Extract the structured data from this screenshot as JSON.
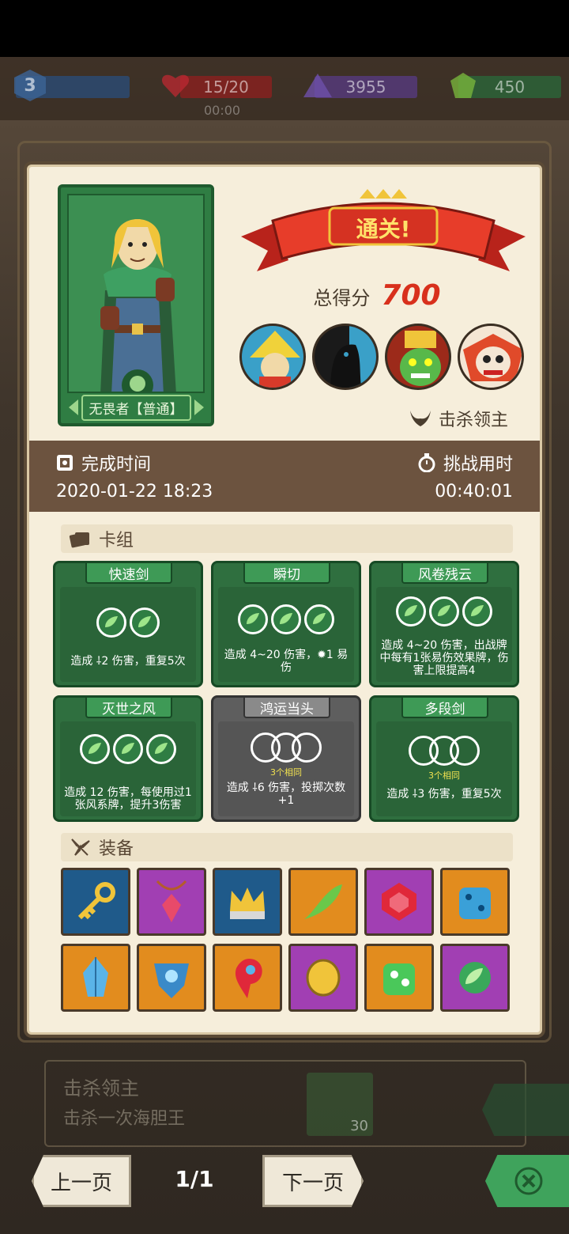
{
  "topbar": {
    "level": "3",
    "hp": "15/20",
    "gems": "3955",
    "money": "450",
    "timer": "00:00"
  },
  "result": {
    "banner": "通关!",
    "score_label": "总得分",
    "score_value": "700",
    "kill_label": "击杀领主"
  },
  "hero": {
    "name": "无畏者【普通】"
  },
  "times": {
    "complete_label": "完成时间",
    "complete_value": "2020-01-22 18:23",
    "challenge_label": "挑战用时",
    "challenge_value": "00:40:01"
  },
  "deck": {
    "title": "卡组",
    "cards": [
      {
        "name": "快速剑",
        "text": "造成 ⸸2 伤害，重复5次"
      },
      {
        "name": "瞬切",
        "text": "造成 4~20 伤害，✹1 易伤"
      },
      {
        "name": "风卷残云",
        "text": "造成 4~20 伤害，出战牌中每有1张易伤效果牌，伤害上限提高4"
      },
      {
        "name": "灭世之风",
        "text": "造成 12 伤害，每使用过1张风系牌，提升3伤害"
      },
      {
        "name": "鸿运当头",
        "note": "3个相同",
        "text": "造成 ⸸6 伤害，投掷次数+1"
      },
      {
        "name": "多段剑",
        "note": "3个相同",
        "text": "造成 ⸸3 伤害，重复5次"
      }
    ]
  },
  "equipment": {
    "title": "装备",
    "items": [
      {
        "icon": "key-icon",
        "color": "#1f5a8a"
      },
      {
        "icon": "pendant-icon",
        "color": "#a13fb3"
      },
      {
        "icon": "crown-icon",
        "color": "#1f5a8a"
      },
      {
        "icon": "feather-icon",
        "color": "#e28c1e"
      },
      {
        "icon": "ruby-icon",
        "color": "#a13fb3"
      },
      {
        "icon": "blue-die-icon",
        "color": "#e28c1e"
      },
      {
        "icon": "crystal-icon",
        "color": "#e28c1e"
      },
      {
        "icon": "shield-gem-icon",
        "color": "#e28c1e"
      },
      {
        "icon": "red-swirl-icon",
        "color": "#e28c1e"
      },
      {
        "icon": "gold-coin-icon",
        "color": "#a13fb3"
      },
      {
        "icon": "green-die-icon",
        "color": "#e28c1e"
      },
      {
        "icon": "wind-orb-icon",
        "color": "#a13fb3"
      }
    ]
  },
  "quest": {
    "title": "击杀领主",
    "desc": "击杀一次海胆王",
    "reward": "30"
  },
  "nav": {
    "prev": "上一页",
    "page": "1/1",
    "next": "下一页"
  }
}
